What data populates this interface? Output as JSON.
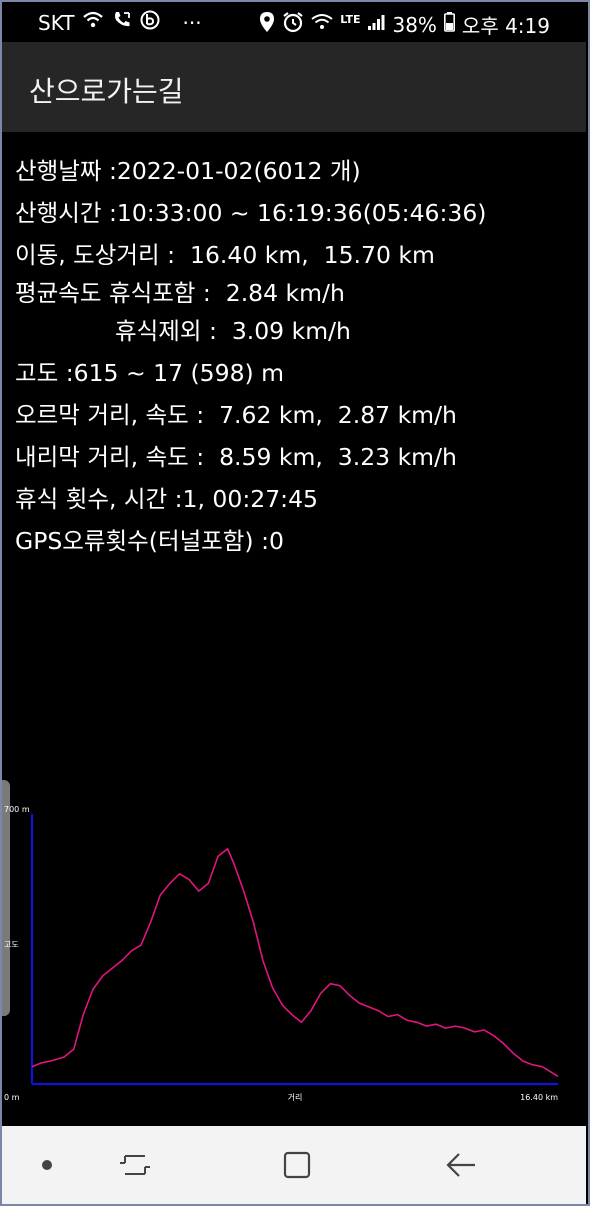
{
  "status_bar": {
    "carrier": "SKT",
    "more": "···",
    "network": "LTE",
    "battery": "38%",
    "time": "오후 4:19"
  },
  "app_bar": {
    "title": "산으로가는길"
  },
  "stats": {
    "date_label": "산행날짜",
    "date_value": "2022-01-02(6012 개)",
    "time_label": "산행시간",
    "time_value": "10:33:00 ~ 16:19:36(05:46:36)",
    "dist_label": "이동, 도상거리",
    "dist_value": "16.40 km,  15.70 km",
    "avg_label": "평균속도 휴식포함",
    "avg_incl_value": "2.84 km/h",
    "avg_excl_label": "휴식제외",
    "avg_excl_value": "3.09 km/h",
    "alt_label": "고도",
    "alt_value": "615 ~ 17 (598) m",
    "up_label": "오르막 거리, 속도",
    "up_value": "7.62 km,  2.87 km/h",
    "down_label": "내리막 거리, 속도",
    "down_value": "8.59 km,  3.23 km/h",
    "rest_label": "휴식 횟수, 시간",
    "rest_value": "1, 00:27:45",
    "gps_label": "GPS오류횟수(터널포함)",
    "gps_value": "0"
  },
  "colors": {
    "axis": "#1010ee",
    "line": "#e0157f",
    "appbar": "#262626",
    "navbar": "#f3f3f3"
  },
  "chart_data": {
    "type": "line",
    "xlabel": "거리",
    "ylabel": "고도",
    "xlim": [
      0,
      16.4
    ],
    "ylim": [
      0,
      700
    ],
    "x_tick_labels": [
      "0 m",
      "16.40 km"
    ],
    "y_tick_labels": [
      "700 m"
    ],
    "series": [
      {
        "x": [
          0,
          0.3,
          0.6,
          1.0,
          1.3,
          1.6,
          1.9,
          2.2,
          2.5,
          2.8,
          3.1,
          3.4,
          3.7,
          4.0,
          4.3,
          4.6,
          4.9,
          5.2,
          5.5,
          5.8,
          6.1,
          6.3,
          6.6,
          6.9,
          7.2,
          7.5,
          7.8,
          8.1,
          8.4,
          8.7,
          9.0,
          9.3,
          9.6,
          9.9,
          10.2,
          10.5,
          10.8,
          11.1,
          11.4,
          11.7,
          12.0,
          12.3,
          12.6,
          12.9,
          13.2,
          13.5,
          13.8,
          14.1,
          14.4,
          14.7,
          15.0,
          15.3,
          15.6,
          15.9,
          16.2,
          16.4
        ],
        "y": [
          45,
          55,
          60,
          70,
          90,
          180,
          245,
          280,
          300,
          320,
          345,
          360,
          420,
          490,
          520,
          545,
          530,
          500,
          520,
          590,
          610,
          570,
          500,
          420,
          320,
          250,
          205,
          180,
          160,
          190,
          235,
          260,
          255,
          230,
          210,
          200,
          190,
          175,
          180,
          165,
          160,
          150,
          155,
          145,
          150,
          145,
          135,
          140,
          125,
          105,
          80,
          60,
          50,
          45,
          30,
          20
        ]
      }
    ]
  }
}
